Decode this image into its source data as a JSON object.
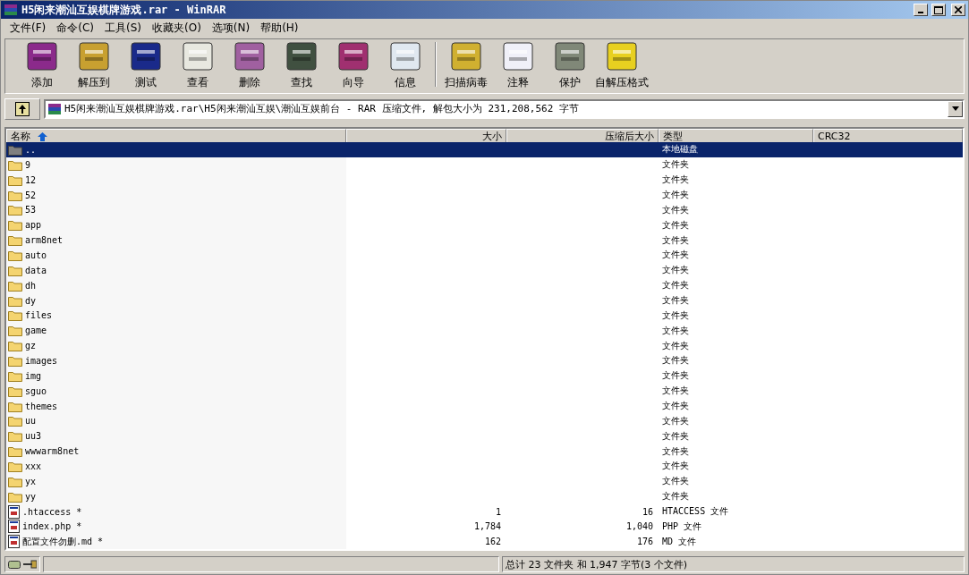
{
  "window": {
    "title": "H5闲来潮汕互娱棋牌游戏.rar - WinRAR"
  },
  "menu": [
    "文件(F)",
    "命令(C)",
    "工具(S)",
    "收藏夹(O)",
    "选项(N)",
    "帮助(H)"
  ],
  "toolbar": [
    {
      "label": "添加"
    },
    {
      "label": "解压到"
    },
    {
      "label": "测试"
    },
    {
      "label": "查看"
    },
    {
      "label": "删除"
    },
    {
      "label": "查找"
    },
    {
      "label": "向导"
    },
    {
      "label": "信息"
    },
    {
      "label": "扫描病毒"
    },
    {
      "label": "注释"
    },
    {
      "label": "保护"
    },
    {
      "label": "自解压格式"
    }
  ],
  "address": "H5闲来潮汕互娱棋牌游戏.rar\\H5闲来潮汕互娱\\潮汕互娱前台 - RAR 压缩文件, 解包大小为 231,208,562 字节",
  "table": {
    "columns": [
      "名称",
      "大小",
      "压缩后大小",
      "类型",
      "CRC32"
    ],
    "rows": [
      {
        "kind": "parent",
        "name": "..",
        "size": "",
        "packed": "",
        "type": "本地磁盘",
        "selected": true
      },
      {
        "kind": "folder",
        "name": "9",
        "size": "",
        "packed": "",
        "type": "文件夹",
        "selected": false
      },
      {
        "kind": "folder",
        "name": "12",
        "size": "",
        "packed": "",
        "type": "文件夹",
        "selected": false
      },
      {
        "kind": "folder",
        "name": "52",
        "size": "",
        "packed": "",
        "type": "文件夹",
        "selected": false
      },
      {
        "kind": "folder",
        "name": "53",
        "size": "",
        "packed": "",
        "type": "文件夹",
        "selected": false
      },
      {
        "kind": "folder",
        "name": "app",
        "size": "",
        "packed": "",
        "type": "文件夹",
        "selected": false
      },
      {
        "kind": "folder",
        "name": "arm8net",
        "size": "",
        "packed": "",
        "type": "文件夹",
        "selected": false
      },
      {
        "kind": "folder",
        "name": "auto",
        "size": "",
        "packed": "",
        "type": "文件夹",
        "selected": false
      },
      {
        "kind": "folder",
        "name": "data",
        "size": "",
        "packed": "",
        "type": "文件夹",
        "selected": false
      },
      {
        "kind": "folder",
        "name": "dh",
        "size": "",
        "packed": "",
        "type": "文件夹",
        "selected": false
      },
      {
        "kind": "folder",
        "name": "dy",
        "size": "",
        "packed": "",
        "type": "文件夹",
        "selected": false
      },
      {
        "kind": "folder",
        "name": "files",
        "size": "",
        "packed": "",
        "type": "文件夹",
        "selected": false
      },
      {
        "kind": "folder",
        "name": "game",
        "size": "",
        "packed": "",
        "type": "文件夹",
        "selected": false
      },
      {
        "kind": "folder",
        "name": "gz",
        "size": "",
        "packed": "",
        "type": "文件夹",
        "selected": false
      },
      {
        "kind": "folder",
        "name": "images",
        "size": "",
        "packed": "",
        "type": "文件夹",
        "selected": false
      },
      {
        "kind": "folder",
        "name": "img",
        "size": "",
        "packed": "",
        "type": "文件夹",
        "selected": false
      },
      {
        "kind": "folder",
        "name": "sguo",
        "size": "",
        "packed": "",
        "type": "文件夹",
        "selected": false
      },
      {
        "kind": "folder",
        "name": "themes",
        "size": "",
        "packed": "",
        "type": "文件夹",
        "selected": false
      },
      {
        "kind": "folder",
        "name": "uu",
        "size": "",
        "packed": "",
        "type": "文件夹",
        "selected": false
      },
      {
        "kind": "folder",
        "name": "uu3",
        "size": "",
        "packed": "",
        "type": "文件夹",
        "selected": false
      },
      {
        "kind": "folder",
        "name": "wwwarm8net",
        "size": "",
        "packed": "",
        "type": "文件夹",
        "selected": false
      },
      {
        "kind": "folder",
        "name": "xxx",
        "size": "",
        "packed": "",
        "type": "文件夹",
        "selected": false
      },
      {
        "kind": "folder",
        "name": "yx",
        "size": "",
        "packed": "",
        "type": "文件夹",
        "selected": false
      },
      {
        "kind": "folder",
        "name": "yy",
        "size": "",
        "packed": "",
        "type": "文件夹",
        "selected": false
      },
      {
        "kind": "file",
        "name": ".htaccess *",
        "size": "1",
        "packed": "16",
        "type": "HTACCESS 文件",
        "selected": false
      },
      {
        "kind": "file",
        "name": "index.php *",
        "size": "1,784",
        "packed": "1,040",
        "type": "PHP 文件",
        "selected": false
      },
      {
        "kind": "file",
        "name": "配置文件勿删.md *",
        "size": "162",
        "packed": "176",
        "type": "MD 文件",
        "selected": false
      }
    ]
  },
  "status_bar": "总计 23 文件夹 和 1,947 字节(3 个文件)"
}
